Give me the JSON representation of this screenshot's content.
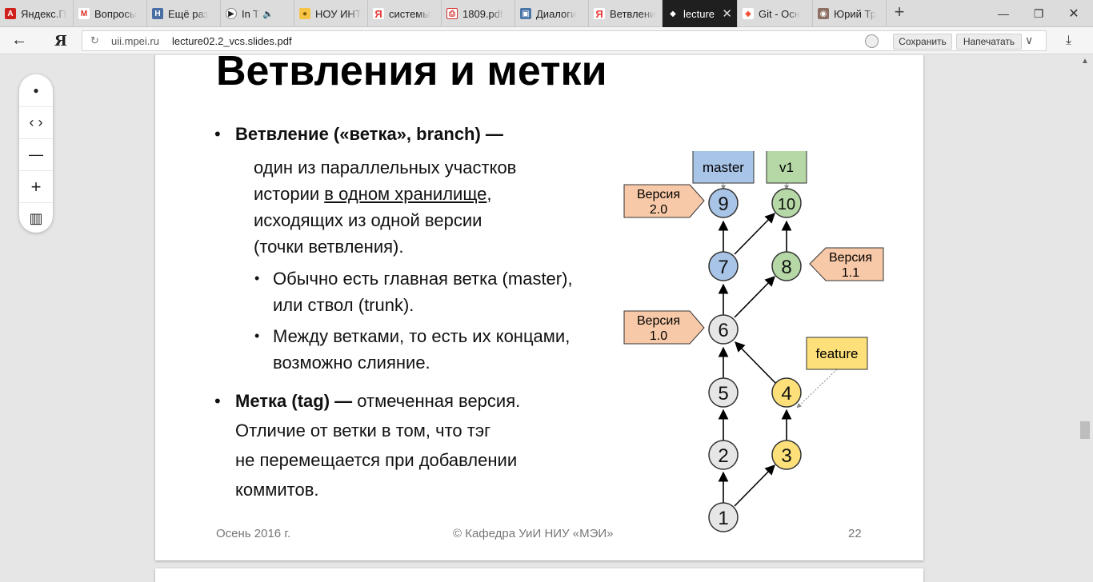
{
  "tabs": [
    {
      "title": "Яндекс.П",
      "favicon": "A",
      "favicon_color": "#d0201e"
    },
    {
      "title": "Вопросы",
      "favicon": "M",
      "favicon_color": "#d93025"
    },
    {
      "title": "Ещё раз",
      "favicon": "H",
      "favicon_color": "#4a6fa5"
    },
    {
      "title": "In T",
      "favicon": "▶",
      "favicon_color": "#222222"
    },
    {
      "title": "НОУ ИНТ",
      "favicon": "●",
      "favicon_color": "#e8b400"
    },
    {
      "title": "системы",
      "favicon": "Я",
      "favicon_color": "#e53935"
    },
    {
      "title": "1809.pdf",
      "favicon": "⎙",
      "favicon_color": "#d32f2f"
    },
    {
      "title": "Диалоги",
      "favicon": "▣",
      "favicon_color": "#4a76a8"
    },
    {
      "title": "Ветвлени",
      "favicon": "Я",
      "favicon_color": "#e53935"
    },
    {
      "title": "lecture",
      "favicon": "◆",
      "favicon_color": "#333333",
      "close": "✕"
    },
    {
      "title": "Git - Осн",
      "favicon": "◆",
      "favicon_color": "#f05033"
    },
    {
      "title": "Юрий Тр",
      "favicon": "◉",
      "favicon_color": "#8d6e63"
    }
  ],
  "window": {
    "new_tab": "+",
    "minimize": "—",
    "restore": "❐",
    "close": "✕"
  },
  "address": {
    "back": "←",
    "logo": "Я",
    "reload": "↻",
    "domain": "uii.mpei.ru",
    "path": "lecture02.2_vcs.slides.pdf",
    "save_label": "Сохранить",
    "print_label": "Напечатать",
    "menu": "∨",
    "download": "⤓"
  },
  "viewer_toolbar": {
    "icons": [
      "●",
      "‹ ›",
      "—",
      "+",
      "▥"
    ]
  },
  "slide": {
    "title": "Ветвления и метки",
    "bullet1_head": "Ветвление («ветка», branch) —",
    "def_line1": "один из параллельных участков",
    "def_line2_a": "истории ",
    "def_line2_u": "в одном хранилище",
    "def_line2_b": ",",
    "def_line3": "исходящих из одной версии",
    "def_line4": "(точки ветвления).",
    "sub1_line1": "Обычно есть главная ветка (master),",
    "sub1_line2": "или ствол (trunk).",
    "sub2_line1": "Между ветками, то есть их концами,",
    "sub2_line2": "возможно слияние.",
    "bullet2_head": "Метка (tag) —",
    "bullet2_rest": " отмеченная версия.",
    "b2_line2": "Отличие от ветки в том, что тэг",
    "b2_line3": "не перемещается при добавлении",
    "b2_line4": "коммитов.",
    "footer_left": "Осень 2016 г.",
    "footer_center": "© Кафедра УиИ НИУ «МЭИ»",
    "footer_right": "22"
  },
  "diagram": {
    "colors": {
      "master": "#a8c4e6",
      "v1": "#b5d8a6",
      "feature": "#fde07a",
      "grey": "#e6e6e6",
      "tag": "#f7c9a8"
    },
    "commits": [
      "1",
      "2",
      "3",
      "4",
      "5",
      "6",
      "7",
      "8",
      "9",
      "10"
    ],
    "labels": {
      "master": "master",
      "v1": "v1",
      "feature": "feature"
    },
    "tags": [
      {
        "line1": "Версия",
        "line2": "2.0"
      },
      {
        "line1": "Версия",
        "line2": "1.1"
      },
      {
        "line1": "Версия",
        "line2": "1.0"
      }
    ]
  }
}
